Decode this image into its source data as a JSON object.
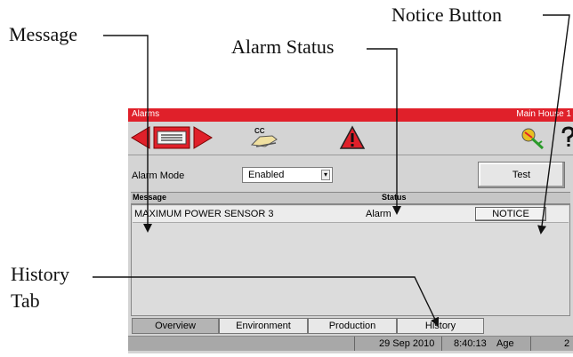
{
  "callouts": {
    "message": "Message",
    "alarm_status": "Alarm Status",
    "notice_button": "Notice Button",
    "history_tab_line1": "History",
    "history_tab_line2": "Tab"
  },
  "window": {
    "title": "Alarms",
    "location": "Main House 1",
    "titlebar_color": "#e0202a"
  },
  "toolbar": {
    "icons": [
      "back-arrow-icon",
      "list-icon",
      "forward-arrow-icon",
      "cc-hand-icon",
      "warning-icon",
      "key-icon",
      "help-icon"
    ]
  },
  "alarm_mode": {
    "label": "Alarm Mode",
    "value": "Enabled"
  },
  "test_button": "Test",
  "table": {
    "headers": {
      "message": "Message",
      "status": "Status"
    },
    "rows": [
      {
        "message": "MAXIMUM POWER SENSOR  3",
        "status": "Alarm",
        "action": "NOTICE"
      }
    ]
  },
  "tabs": [
    "Overview",
    "Environment",
    "Production",
    "History"
  ],
  "active_tab": "Overview",
  "statusbar": {
    "date": "29 Sep 2010",
    "time": "8:40:13",
    "age_label": "Age",
    "age_value": "2"
  }
}
